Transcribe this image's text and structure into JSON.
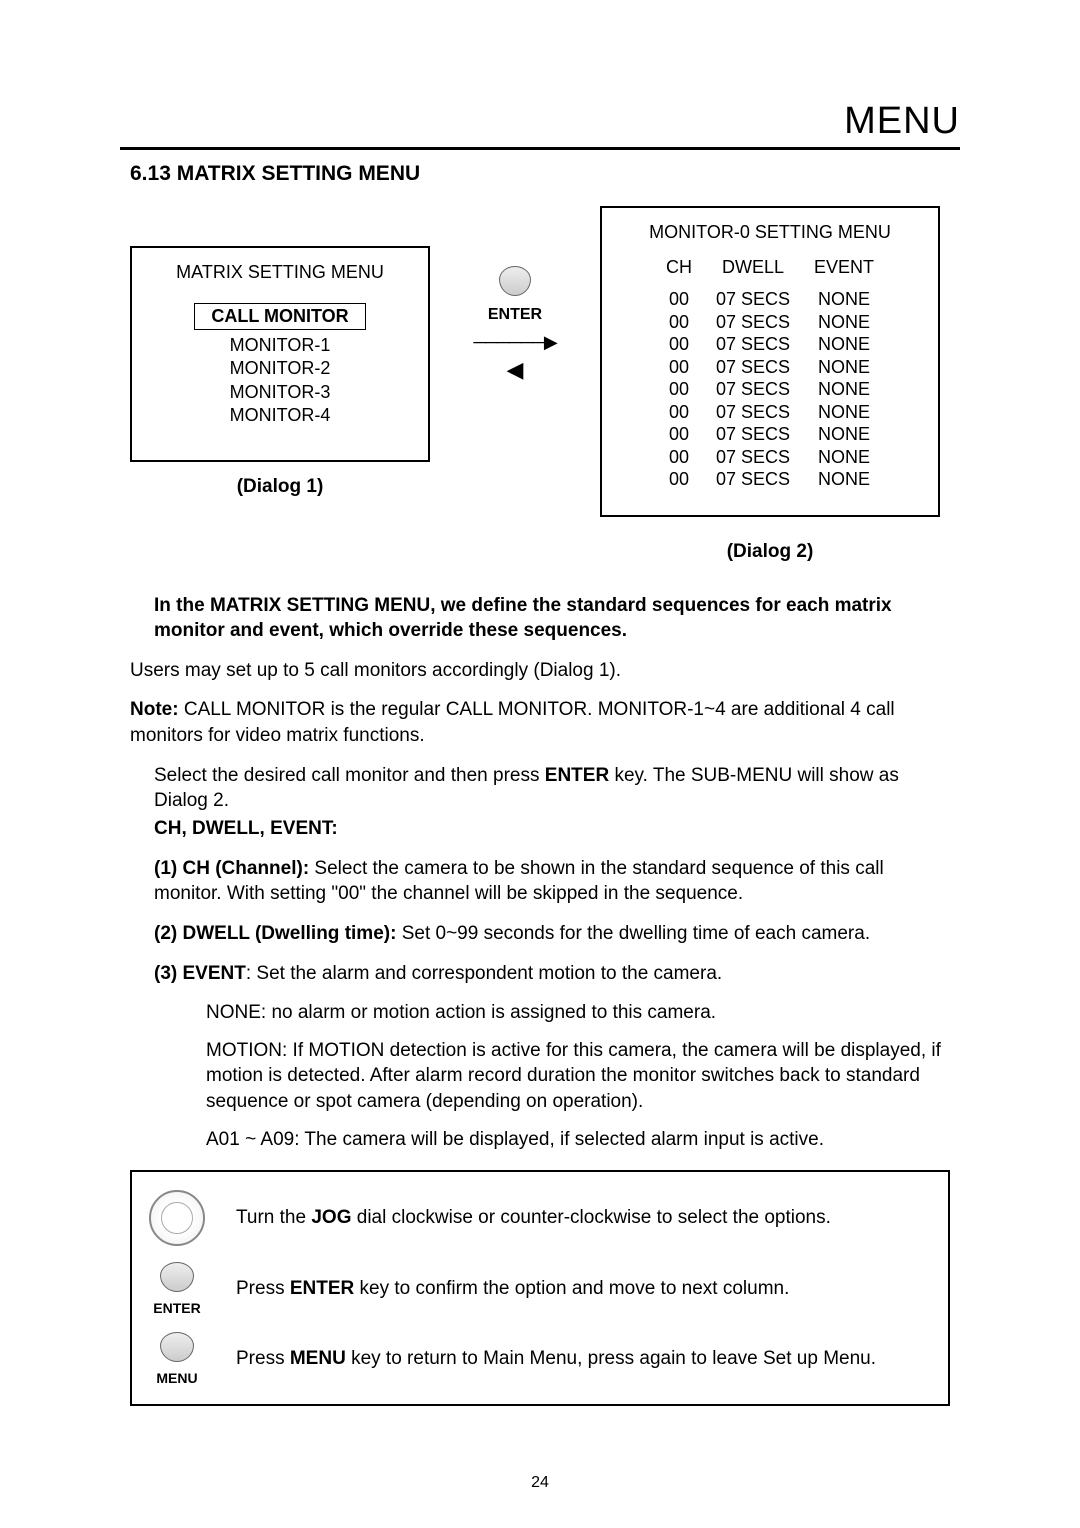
{
  "header": {
    "title": "MENU"
  },
  "section": {
    "heading": "6.13 MATRIX SETTING MENU"
  },
  "dialog1": {
    "title": "MATRIX  SETTING MENU",
    "selected": "CALL MONITOR",
    "items": [
      "MONITOR-1",
      "MONITOR-2",
      "MONITOR-3",
      "MONITOR-4"
    ],
    "label": "(Dialog 1)"
  },
  "mid": {
    "enter_label": "ENTER",
    "arrow_right": "──────▶",
    "arrow_left": "◀"
  },
  "dialog2": {
    "title": "MONITOR-0  SETTING MENU",
    "headers": {
      "ch": "CH",
      "dwell": "DWELL",
      "event": "EVENT"
    },
    "rows": [
      {
        "ch": "00",
        "dwell": "07 SECS",
        "event": "NONE"
      },
      {
        "ch": "00",
        "dwell": "07 SECS",
        "event": "NONE"
      },
      {
        "ch": "00",
        "dwell": "07 SECS",
        "event": "NONE"
      },
      {
        "ch": "00",
        "dwell": "07 SECS",
        "event": "NONE"
      },
      {
        "ch": "00",
        "dwell": "07 SECS",
        "event": "NONE"
      },
      {
        "ch": "00",
        "dwell": "07 SECS",
        "event": "NONE"
      },
      {
        "ch": "00",
        "dwell": "07 SECS",
        "event": "NONE"
      },
      {
        "ch": "00",
        "dwell": "07 SECS",
        "event": "NONE"
      },
      {
        "ch": "00",
        "dwell": "07 SECS",
        "event": "NONE"
      }
    ],
    "label": "(Dialog 2)"
  },
  "body": {
    "intro_bold": "In the MATRIX SETTING MENU, we define the standard sequences for each matrix monitor and event, which override these sequences.",
    "p1": "Users may set up to 5 call monitors accordingly (Dialog 1).",
    "note_label": "Note:",
    "note_text": " CALL MONITOR is the regular CALL MONITOR. MONITOR-1~4 are additional 4 call monitors for video matrix functions.",
    "p3_a": "Select the desired call monitor and then press ",
    "p3_enter": "ENTER",
    "p3_b": " key. The SUB-MENU will show as Dialog 2.",
    "ch_dwell_event": "CH, DWELL, EVENT:",
    "item1_label": "(1) CH (Channel):",
    "item1_text": " Select the camera to be shown in the standard sequence of this call monitor. With setting \"00\" the channel will be skipped in the sequence.",
    "item2_label": "(2) DWELL (Dwelling time):",
    "item2_text": " Set 0~99 seconds for the dwelling time of each camera.",
    "item3_label": "(3) EVENT",
    "item3_text": ": Set the alarm and correspondent motion to the camera.",
    "ev_none": "NONE: no alarm or motion action is assigned to this camera.",
    "ev_motion": "MOTION: If MOTION detection is active for this camera, the camera will be displayed, if motion is detected. After alarm record duration the monitor switches back to standard sequence or spot camera (depending on operation).",
    "ev_alarm": "A01 ~ A09: The camera will be displayed, if selected alarm input is active."
  },
  "instructions": {
    "jog_a": "Turn the ",
    "jog_bold": "JOG",
    "jog_b": " dial clockwise or counter-clockwise to select the options.",
    "enter_a": "Press ",
    "enter_bold": "ENTER",
    "enter_b": " key to confirm the option and move to next column.",
    "enter_label": "ENTER",
    "menu_a": "Press ",
    "menu_bold": "MENU",
    "menu_b": " key to return to Main Menu, press again to leave Set up Menu.",
    "menu_label": "MENU"
  },
  "page_number": "24"
}
